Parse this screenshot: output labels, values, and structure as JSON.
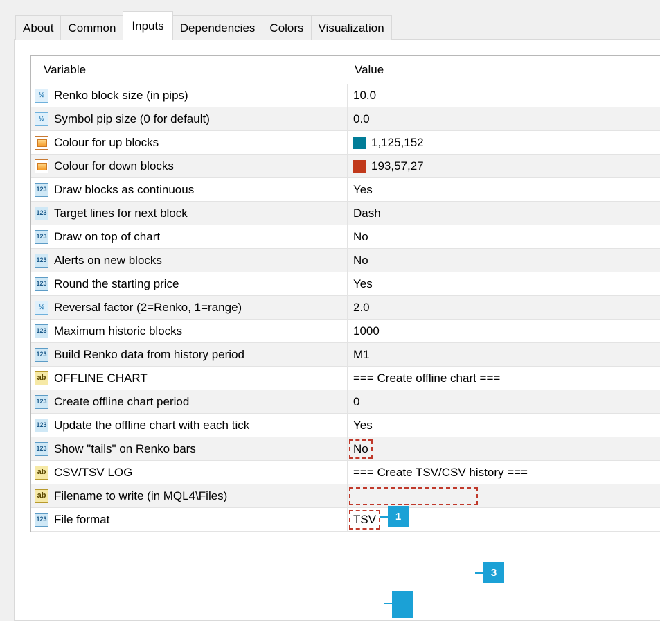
{
  "tabs": [
    "About",
    "Common",
    "Inputs",
    "Dependencies",
    "Colors",
    "Visualization"
  ],
  "active_tab": "Inputs",
  "grid": {
    "header": {
      "variable": "Variable",
      "value": "Value"
    },
    "rows": [
      {
        "icon": "fraction-icon",
        "icon_text": "½",
        "variable": "Renko block size (in pips)",
        "value": "10.0"
      },
      {
        "icon": "fraction-icon",
        "icon_text": "½",
        "variable": "Symbol pip size (0 for default)",
        "value": "0.0"
      },
      {
        "icon": "color-icon",
        "icon_text": "",
        "variable": "Colour for up blocks",
        "value": "1,125,152",
        "swatch": "#017d98"
      },
      {
        "icon": "color-icon",
        "icon_text": "",
        "variable": "Colour for down blocks",
        "value": "193,57,27",
        "swatch": "#c1391b"
      },
      {
        "icon": "number-icon",
        "icon_text": "123",
        "variable": "Draw blocks as continuous",
        "value": "Yes"
      },
      {
        "icon": "number-icon",
        "icon_text": "123",
        "variable": "Target lines for next block",
        "value": "Dash"
      },
      {
        "icon": "number-icon",
        "icon_text": "123",
        "variable": "Draw on top of chart",
        "value": "No"
      },
      {
        "icon": "number-icon",
        "icon_text": "123",
        "variable": "Alerts on new blocks",
        "value": "No"
      },
      {
        "icon": "number-icon",
        "icon_text": "123",
        "variable": "Round the starting price",
        "value": "Yes"
      },
      {
        "icon": "fraction-icon",
        "icon_text": "½",
        "variable": "Reversal factor (2=Renko, 1=range)",
        "value": "2.0"
      },
      {
        "icon": "number-icon",
        "icon_text": "123",
        "variable": "Maximum historic blocks",
        "value": "1000"
      },
      {
        "icon": "number-icon",
        "icon_text": "123",
        "variable": "Build Renko data from history period",
        "value": "M1"
      },
      {
        "icon": "string-icon",
        "icon_text": "ab",
        "variable": "OFFLINE CHART",
        "value": "=== Create offline chart  ==="
      },
      {
        "icon": "number-icon",
        "icon_text": "123",
        "variable": "Create offline chart period",
        "value": "0"
      },
      {
        "icon": "number-icon",
        "icon_text": "123",
        "variable": "Update the offline chart with each tick",
        "value": "Yes"
      },
      {
        "icon": "number-icon",
        "icon_text": "123",
        "variable": "Show \"tails\" on Renko bars",
        "value": "No",
        "highlight": true
      },
      {
        "icon": "string-icon",
        "icon_text": "ab",
        "variable": "CSV/TSV LOG",
        "value": "=== Create TSV/CSV history ==="
      },
      {
        "icon": "string-icon",
        "icon_text": "ab",
        "variable": "Filename to write (in MQL4\\Files)",
        "value": "",
        "highlight": true
      },
      {
        "icon": "number-icon",
        "icon_text": "123",
        "variable": "File format",
        "value": "TSV",
        "highlight": true
      }
    ]
  },
  "callouts": [
    "1",
    "3",
    ""
  ],
  "colors": {
    "accent": "#1ba1d6",
    "highlight_border": "#c0392b"
  }
}
